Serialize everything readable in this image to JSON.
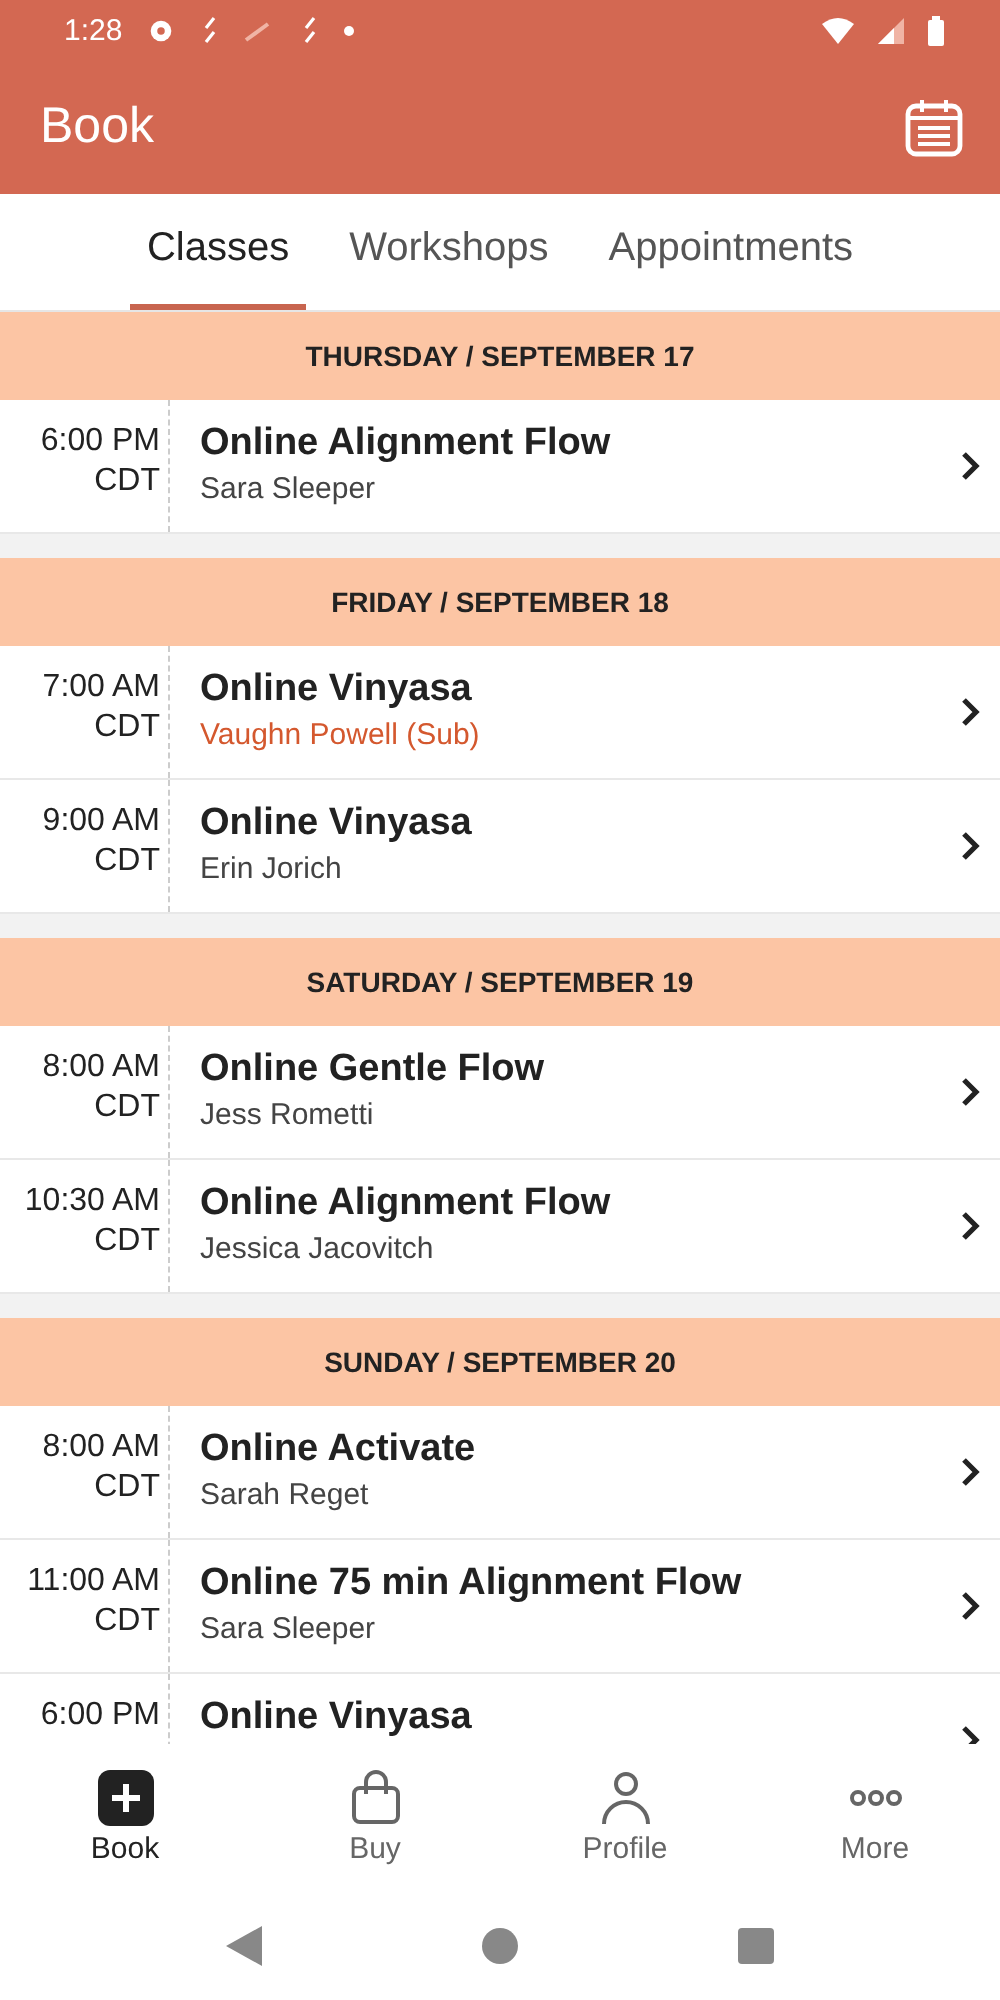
{
  "status_bar": {
    "time": "1:28"
  },
  "app_bar": {
    "title": "Book"
  },
  "tabs": [
    {
      "label": "Classes",
      "selected": true
    },
    {
      "label": "Workshops",
      "selected": false
    },
    {
      "label": "Appointments",
      "selected": false
    }
  ],
  "days": [
    {
      "heading": "THURSDAY / SEPTEMBER 17",
      "classes": [
        {
          "time": "6:00 PM",
          "zone": "CDT",
          "title": "Online Alignment Flow",
          "instructor": "Sara Sleeper",
          "substitute": false
        }
      ]
    },
    {
      "heading": "FRIDAY / SEPTEMBER 18",
      "classes": [
        {
          "time": "7:00 AM",
          "zone": "CDT",
          "title": "Online Vinyasa",
          "instructor": "Vaughn Powell (Sub)",
          "substitute": true
        },
        {
          "time": "9:00 AM",
          "zone": "CDT",
          "title": "Online Vinyasa",
          "instructor": "Erin Jorich",
          "substitute": false
        }
      ]
    },
    {
      "heading": "SATURDAY / SEPTEMBER 19",
      "classes": [
        {
          "time": "8:00 AM",
          "zone": "CDT",
          "title": "Online Gentle Flow",
          "instructor": "Jess Rometti",
          "substitute": false
        },
        {
          "time": "10:30 AM",
          "zone": "CDT",
          "title": "Online Alignment Flow",
          "instructor": "Jessica Jacovitch",
          "substitute": false
        }
      ]
    },
    {
      "heading": "SUNDAY / SEPTEMBER 20",
      "classes": [
        {
          "time": "8:00 AM",
          "zone": "CDT",
          "title": "Online Activate",
          "instructor": "Sarah Reget",
          "substitute": false
        },
        {
          "time": "11:00 AM",
          "zone": "CDT",
          "title": "Online 75 min Alignment Flow",
          "instructor": "Sara Sleeper",
          "substitute": false
        },
        {
          "time": "6:00 PM",
          "title": "Online Vinyasa"
        }
      ]
    }
  ],
  "bottom_nav": [
    {
      "kind": "book",
      "label": "Book",
      "selected": true
    },
    {
      "kind": "buy",
      "label": "Buy",
      "selected": false
    },
    {
      "kind": "profile",
      "label": "Profile",
      "selected": false
    },
    {
      "kind": "more",
      "label": "More",
      "selected": false
    }
  ]
}
